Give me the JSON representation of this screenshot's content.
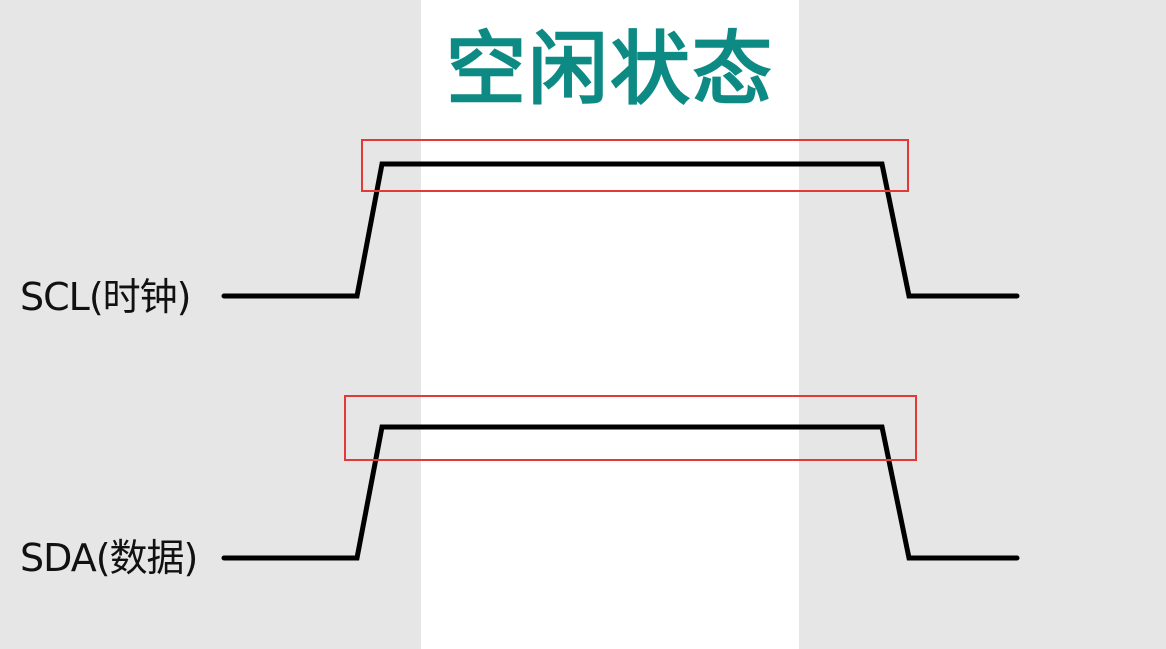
{
  "title": "空闲状态",
  "signals": [
    {
      "label": "SCL(时钟)"
    },
    {
      "label": "SDA(数据)"
    }
  ],
  "colors": {
    "background": "#e6e6e6",
    "band": "#ffffff",
    "title": "#0e8a84",
    "waveform": "#000000",
    "highlight": "#e53935"
  }
}
